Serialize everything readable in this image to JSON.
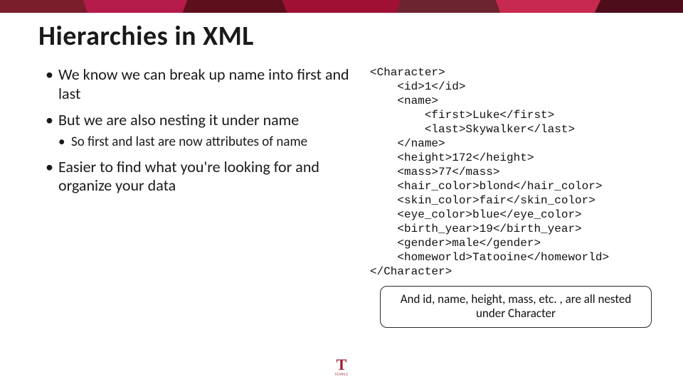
{
  "title": "Hierarchies in XML",
  "bullets": {
    "b1": "We know we can break up name into first and last",
    "b2": "But we are also nesting it under name",
    "b2a": "So first and last are now attributes of name",
    "b3": "Easier to find what you're looking for and organize your data"
  },
  "code": "<Character>\n    <id>1</id>\n    <name>\n        <first>Luke</first>\n        <last>Skywalker</last>\n    </name>\n    <height>172</height>\n    <mass>77</mass>\n    <hair_color>blond</hair_color>\n    <skin_color>fair</skin_color>\n    <eye_color>blue</eye_color>\n    <birth_year>19</birth_year>\n    <gender>male</gender>\n    <homeworld>Tatooine</homeworld>\n</Character>",
  "callout": "And id, name, height, mass, etc. , are all nested under Character",
  "logo": {
    "letter": "T",
    "word": "TEMPLE"
  }
}
